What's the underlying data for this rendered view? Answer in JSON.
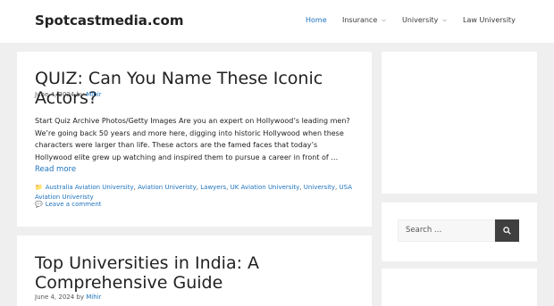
{
  "site": {
    "name": "Spotcastmedia.com"
  },
  "nav": [
    {
      "label": "Home"
    },
    {
      "label": "Insurance"
    },
    {
      "label": "University"
    },
    {
      "label": "Law University"
    }
  ],
  "posts": [
    {
      "title": "QUIZ: Can You Name These Iconic Actors?",
      "date": "June 4, 2024",
      "by": "by",
      "author": "Mihir",
      "excerpt": "Start Quiz Archive Photos/Getty Images Are you an expert on Hollywood’s leading men? We’re going back 50 years and more here, digging into historic Hollywood when these characters were larger than life. These actors are the famed faces that today’s Hollywood elite grew up watching and inspired them to pursue a career in front of …",
      "read_more": "Read more",
      "categories": [
        "Australia Aviation University",
        "Aviation Univeristy",
        "Lawyers",
        "UK Aviation University",
        "University",
        "USA Aviation Univeristy"
      ],
      "separator": ",",
      "comment": "Leave a comment"
    },
    {
      "title": "Top Universities in India: A Comprehensive Guide",
      "date": "June 4, 2024",
      "by": "by",
      "author": "Mihir"
    }
  ],
  "search": {
    "placeholder": "Search …"
  },
  "colors": {
    "accent": "#1e73be",
    "background": "#efefef",
    "button": "#3f3f3f"
  },
  "icons": {
    "category": "folder-icon",
    "comment": "comment-icon",
    "search": "search-icon",
    "dropdown": "chevron-down-icon"
  }
}
